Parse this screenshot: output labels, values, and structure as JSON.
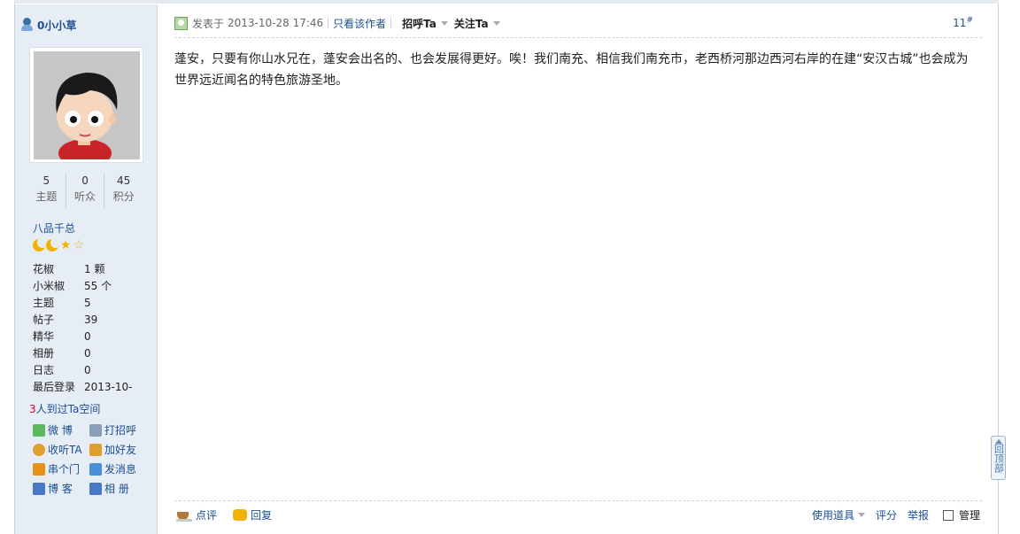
{
  "author": {
    "name": "0小小草",
    "stats": [
      {
        "value": "5",
        "label": "主题"
      },
      {
        "value": "0",
        "label": "听众"
      },
      {
        "value": "45",
        "label": "积分"
      }
    ],
    "rank": "八品千总",
    "info": [
      {
        "key": "花椒",
        "value": "1 颗"
      },
      {
        "key": "小米椒",
        "value": "55 个"
      },
      {
        "key": "主题",
        "value": "5"
      },
      {
        "key": "帖子",
        "value": "39"
      },
      {
        "key": "精华",
        "value": "0"
      },
      {
        "key": "相册",
        "value": "0"
      },
      {
        "key": "日志",
        "value": "0"
      },
      {
        "key": "最后登录",
        "value": "2013-10-"
      }
    ],
    "visitors": {
      "count": "3",
      "text": "人到过Ta空间"
    },
    "actions": [
      {
        "label": "微 博",
        "icon": "weibo-icon",
        "color": "#5cb85c"
      },
      {
        "label": "打招呼",
        "icon": "wave-icon",
        "color": "#8aa0b8"
      },
      {
        "label": "收听TA",
        "icon": "listen-icon",
        "color": "#e0a030"
      },
      {
        "label": "加好友",
        "icon": "add-friend-icon",
        "color": "#e0a030"
      },
      {
        "label": "串个门",
        "icon": "home-icon",
        "color": "#e8901a"
      },
      {
        "label": "发消息",
        "icon": "message-icon",
        "color": "#4a90d9"
      },
      {
        "label": "博 客",
        "icon": "blog-icon",
        "color": "#4a78c8"
      },
      {
        "label": "相 册",
        "icon": "album-icon",
        "color": "#4a78c8"
      }
    ]
  },
  "post": {
    "posted_label": "发表于",
    "posted_time": "2013-10-28 17:46",
    "only_author": "只看该作者",
    "greet": "招呼Ta",
    "follow": "关注Ta",
    "floor_number": "11",
    "floor_mark": "#",
    "body": "蓬安，只要有你山水兄在，蓬安会出名的、也会发展得更好。唉！我们南充、相信我们南充市，老西桥河那边西河右岸的在建“安汉古城”也会成为世界远近闻名的特色旅游圣地。"
  },
  "footer": {
    "comment": "点评",
    "reply": "回复",
    "tools": "使用道具",
    "rate": "评分",
    "report": "举报",
    "manage": "管理"
  },
  "back_to_top": "回顶部"
}
